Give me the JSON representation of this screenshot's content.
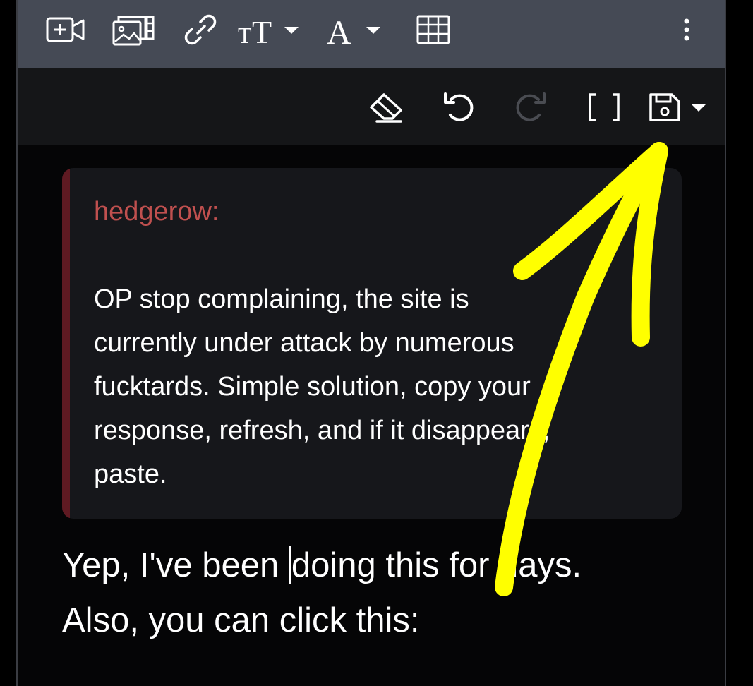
{
  "toolbar": {
    "buttons": [
      {
        "name": "insert-video-icon"
      },
      {
        "name": "insert-image-gallery-icon"
      },
      {
        "name": "link-icon"
      },
      {
        "name": "text-size-icon"
      },
      {
        "name": "text-color-icon"
      },
      {
        "name": "table-icon"
      },
      {
        "name": "more-vertical-icon"
      }
    ],
    "size_label": "TT",
    "color_label": "A"
  },
  "subtoolbar": {
    "buttons": [
      {
        "name": "eraser-icon"
      },
      {
        "name": "undo-icon"
      },
      {
        "name": "redo-icon"
      },
      {
        "name": "fullscreen-brackets-icon"
      },
      {
        "name": "save-icon"
      }
    ],
    "brackets_label": "[ ]"
  },
  "quote": {
    "author": "hedgerow:",
    "lines": [
      "OP stop complaining, the site is",
      "currently under attack by numerous",
      "fucktards. Simple solution, copy your",
      "response, refresh, and if it disappears,",
      "paste."
    ]
  },
  "reply": {
    "line1_before_caret": "Yep, I've been ",
    "line1_after_caret": "doing this for days.",
    "line2": "Also, you can click this:"
  },
  "colors": {
    "toolbar_bg": "#454a55",
    "subtoolbar_bg": "#151618",
    "editor_bg": "#050506",
    "quote_bg": "#16171b",
    "quote_bar": "#5f1a22",
    "author": "#c0504f",
    "annotation": "#ffff00"
  }
}
